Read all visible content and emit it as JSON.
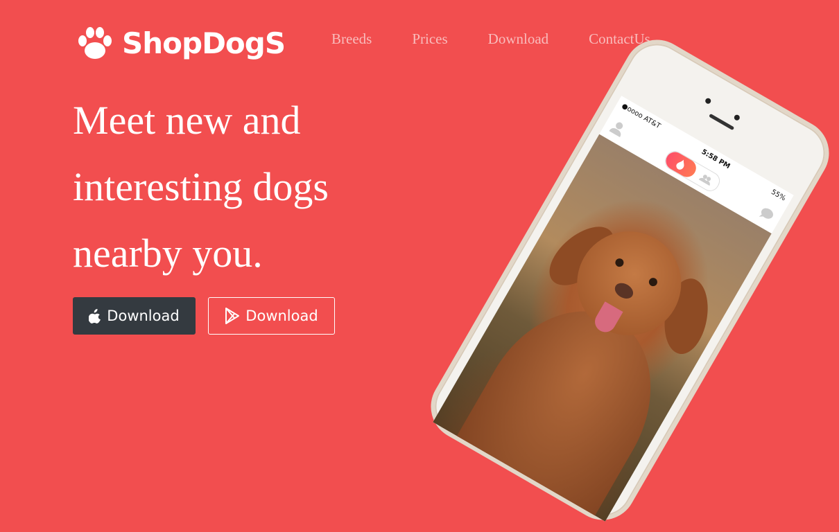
{
  "brand": {
    "name": "ShopDogS",
    "icon": "paw-icon"
  },
  "nav": {
    "items": [
      {
        "label": "Breeds"
      },
      {
        "label": "Prices"
      },
      {
        "label": "Download"
      },
      {
        "label": "ContactUs"
      }
    ]
  },
  "hero": {
    "headline": "Meet new and interesting dogs nearby you.",
    "buttons": {
      "ios": {
        "label": "Download",
        "icon": "apple-icon"
      },
      "android": {
        "label": "Download",
        "icon": "google-play-icon"
      }
    }
  },
  "phone": {
    "carrier": "●oooo AT&T",
    "time": "5:58 PM",
    "battery": "55%"
  },
  "colors": {
    "background": "#f24e4f",
    "nav_text": "#f9bcbc",
    "dark_button": "#343a40"
  }
}
